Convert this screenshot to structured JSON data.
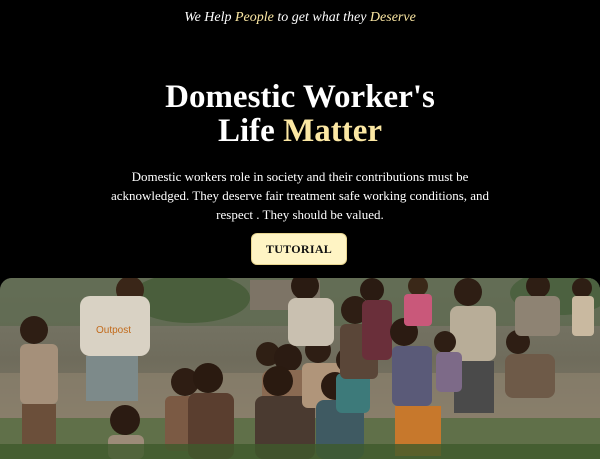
{
  "tagline": {
    "part1": "We Help ",
    "highlight1": "People",
    "part2": " to get what they ",
    "highlight2": "Deserve"
  },
  "headline": {
    "line1": "Domestic Worker's",
    "line2_plain": "Life ",
    "line2_highlight": "Matter"
  },
  "description": "Domestic workers role in society and their contributions must be acknowledged. They deserve fair treatment safe working conditions, and respect . They should be valued.",
  "cta": {
    "label": "TUTORIAL"
  },
  "photo": {
    "shirt_text": "Outpost"
  },
  "colors": {
    "background": "#000000",
    "accent": "#fbe7a3",
    "button_bg": "#fff4c4",
    "text": "#ffffff"
  }
}
